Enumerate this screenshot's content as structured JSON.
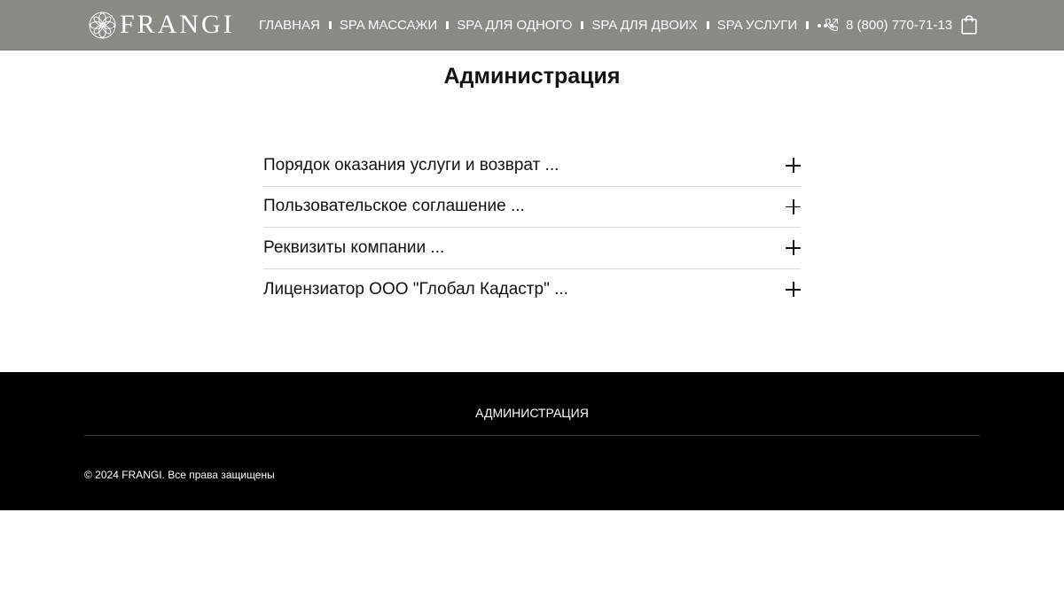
{
  "header": {
    "logo_text": "FRANGI",
    "nav": [
      {
        "label": "ГЛАВНАЯ"
      },
      {
        "label": "SPA МАССАЖИ"
      },
      {
        "label": "SPA ДЛЯ ОДНОГО"
      },
      {
        "label": "SPA ДЛЯ ДВОИХ"
      },
      {
        "label": "SPA УСЛУГИ"
      }
    ],
    "more_icon": "more-dots-icon",
    "phone": "8 (800) 770-71-13",
    "phone_icon": "phone-icon",
    "cart_icon": "shopping-bag-icon",
    "bg_color": "#8c8985"
  },
  "main": {
    "title": "Администрация",
    "accordion": [
      {
        "label": "Порядок оказания услуги и возврат ..."
      },
      {
        "label": "Пользовательское соглашение ..."
      },
      {
        "label": "Реквизиты компании ..."
      },
      {
        "label": "Лицензиатор ООО \"Глобал Кадастр\" ..."
      }
    ],
    "expand_icon": "plus-icon"
  },
  "footer": {
    "link": "АДМИНИСТРАЦИЯ",
    "copyright": "© 2024 FRANGI. Все права защищены",
    "bg_color": "#000000"
  }
}
